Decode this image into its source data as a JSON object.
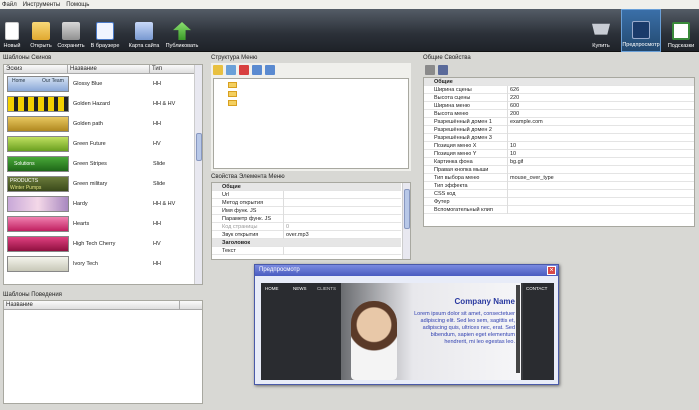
{
  "menu": [
    "Файл",
    "Инструменты",
    "Помощь"
  ],
  "toolbar": {
    "items": [
      {
        "label": "Новый",
        "icon": "new-file-icon"
      },
      {
        "label": "Открыть",
        "icon": "folder-open-icon"
      },
      {
        "label": "Сохранить",
        "icon": "save-disk-icon"
      },
      {
        "label": "В браузере",
        "icon": "browser-preview-icon"
      },
      {
        "label": "Карта сайта",
        "icon": "sitemap-icon"
      },
      {
        "label": "Публиковать",
        "icon": "publish-arrow-icon"
      }
    ],
    "right": [
      {
        "label": "Купить",
        "icon": "cart-icon"
      },
      {
        "label": "Предпросмотр",
        "icon": "preview-play-icon"
      },
      {
        "label": "Подсказки",
        "icon": "hints-icon"
      }
    ]
  },
  "templates": {
    "title": "Шаблоны Скинов",
    "columns": [
      "Эскиз",
      "Название",
      "Тип"
    ],
    "rows": [
      {
        "name": "Glossy Blue",
        "type": "HH"
      },
      {
        "name": "Golden Hazard",
        "type": "HH & HV"
      },
      {
        "name": "Golden path",
        "type": "HH"
      },
      {
        "name": "Green Future",
        "type": "HV"
      },
      {
        "name": "Green Stripes",
        "type": "Slide"
      },
      {
        "name": "Green military",
        "type": "Slide"
      },
      {
        "name": "Hardy",
        "type": "HH & HV"
      },
      {
        "name": "Hearts",
        "type": "HH"
      },
      {
        "name": "High Tech Cherry",
        "type": "HV"
      },
      {
        "name": "Ivory Tech",
        "type": "HH"
      }
    ],
    "thumb_texts": [
      "Home",
      "Our Team",
      "Solutions",
      "PRODUCTS",
      "Winter Pumps"
    ]
  },
  "behaviors": {
    "title": "Шаблоны Поведения",
    "column": "Название"
  },
  "menu_structure": {
    "title": "Структура Меню"
  },
  "element_props": {
    "title": "Свойства Элемента Меню",
    "group1": "Общие",
    "rows": [
      {
        "k": "Url",
        "v": ""
      },
      {
        "k": "Метод открытия",
        "v": ""
      },
      {
        "k": "Имя функ. JS",
        "v": ""
      },
      {
        "k": "Параметр функ. JS",
        "v": ""
      },
      {
        "k": "Код страницы",
        "v": "0"
      },
      {
        "k": "Звук открытия",
        "v": "over.mp3"
      }
    ],
    "group2": "Заголовок",
    "text_row": "Текст"
  },
  "general": {
    "title": "Общие Свойства",
    "group": "Общие",
    "rows": [
      {
        "k": "Ширина сцены",
        "v": "626"
      },
      {
        "k": "Высота сцены",
        "v": "220"
      },
      {
        "k": "Ширина меню",
        "v": "600"
      },
      {
        "k": "Высота меню",
        "v": "200"
      },
      {
        "k": "Разрешённый домен 1",
        "v": "example.com"
      },
      {
        "k": "Разрешённый домен 2",
        "v": ""
      },
      {
        "k": "Разрешённый домен 3",
        "v": ""
      },
      {
        "k": "Позиция меню X",
        "v": "10"
      },
      {
        "k": "Позиция меню Y",
        "v": "10"
      },
      {
        "k": "Картинка фона",
        "v": "bg.gif"
      },
      {
        "k": "Правая кнопка мыши",
        "v": ""
      },
      {
        "k": "Тип выбора меню",
        "v": "mouse_over_type"
      },
      {
        "k": "Тип эффекта",
        "v": ""
      },
      {
        "k": "CSS код",
        "v": ""
      },
      {
        "k": "Футер",
        "v": ""
      },
      {
        "k": "Вспомогательный клип",
        "v": ""
      }
    ]
  },
  "preview": {
    "title": "Предпросмотр",
    "nav": [
      "HOME",
      "NEWS",
      "CLIENTS"
    ],
    "contact": "CONTACT",
    "company": "Company Name",
    "lorem": "Lorem ipsum dolor sit amet, consectetuer adipiscing elit. Sed leo sem, sagittis et, adipiscing quis, ultrices nec, erat. Sed bibendum, sapien eget elementum hendrerit, mi leo egestas leo.",
    "colors": {
      "title_bar": "#5c6fc9",
      "company": "#2a3aa0",
      "lorem": "#3040b0"
    }
  }
}
